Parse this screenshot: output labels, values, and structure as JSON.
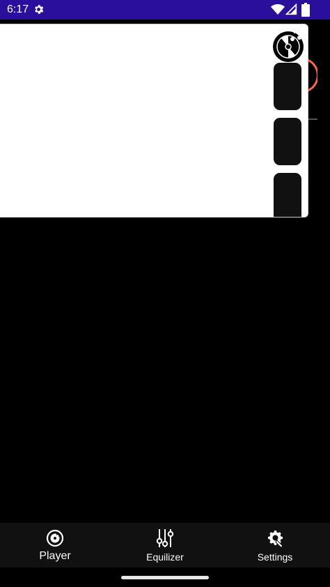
{
  "status_bar": {
    "time": "6:17",
    "background_color": "#2a0f9c"
  },
  "icons": {
    "status_settings": "gear-icon",
    "wifi": "wifi-icon",
    "signal": "signal-icon",
    "battery": "battery-icon",
    "disc": "music-disc-icon",
    "player": "music-disc-icon",
    "equalizer": "equalizer-sliders-icon",
    "settings": "gear-wrench-icon"
  },
  "colors": {
    "accent_ring": "#ff6a3d",
    "nav_background": "#111111",
    "panel_background": "#ffffff"
  },
  "bottom_nav": {
    "items": [
      {
        "label": "Player"
      },
      {
        "label": "Equilizer"
      },
      {
        "label": "Settings"
      }
    ]
  }
}
